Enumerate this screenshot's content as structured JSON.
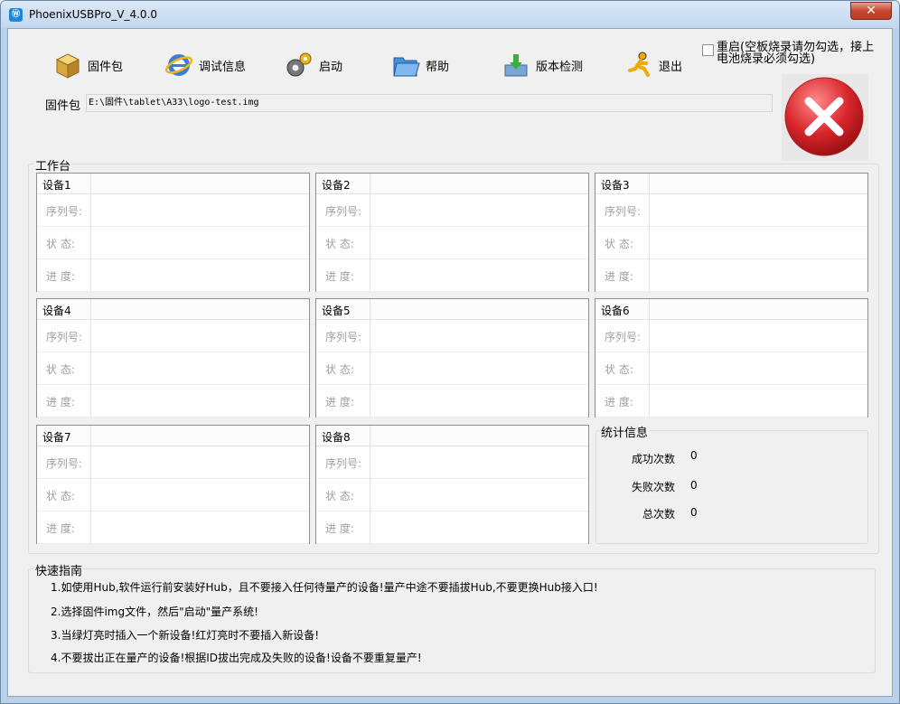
{
  "window": {
    "title": "PhoenixUSBPro_V_4.0.0",
    "app_icon_text": "Ⓦ",
    "close_symbol": "✕"
  },
  "toolbar": {
    "firmware": "固件包",
    "debug": "调试信息",
    "start": "启动",
    "help": "帮助",
    "version": "版本检测",
    "exit": "退出"
  },
  "restart": {
    "label": "重启(空板烧录请勿勾选，接上电池烧录必须勾选)",
    "checked": false
  },
  "firmware_path": {
    "label": "固件包",
    "value": "E:\\固件\\tablet\\A33\\logo-test.img"
  },
  "workbench": {
    "title": "工作台",
    "row_labels": {
      "serial": "序列号:",
      "status": "状  态:",
      "progress": "进  度:"
    },
    "devices": [
      {
        "name": "设备1",
        "serial": "",
        "status": "",
        "progress": ""
      },
      {
        "name": "设备2",
        "serial": "",
        "status": "",
        "progress": ""
      },
      {
        "name": "设备3",
        "serial": "",
        "status": "",
        "progress": ""
      },
      {
        "name": "设备4",
        "serial": "",
        "status": "",
        "progress": ""
      },
      {
        "name": "设备5",
        "serial": "",
        "status": "",
        "progress": ""
      },
      {
        "name": "设备6",
        "serial": "",
        "status": "",
        "progress": ""
      },
      {
        "name": "设备7",
        "serial": "",
        "status": "",
        "progress": ""
      },
      {
        "name": "设备8",
        "serial": "",
        "status": "",
        "progress": ""
      }
    ]
  },
  "stats": {
    "title": "统计信息",
    "success_label": "成功次数",
    "success_value": "0",
    "fail_label": "失败次数",
    "fail_value": "0",
    "total_label": "总次数",
    "total_value": "0"
  },
  "guide": {
    "title": "快速指南",
    "lines": [
      "1.如使用Hub,软件运行前安装好Hub，且不要接入任何待量产的设备!量产中途不要插拔Hub,不要更换Hub接入口!",
      "2.选择固件img文件，然后\"启动\"量产系统!",
      "3.当绿灯亮时插入一个新设备!红灯亮时不要插入新设备!",
      "4.不要拔出正在量产的设备!根据ID拔出完成及失败的设备!设备不要重复量产!"
    ]
  },
  "colors": {
    "status_indicator": "#d8262b",
    "titlebar": "#c2d7ee",
    "close": "#c7442e"
  }
}
